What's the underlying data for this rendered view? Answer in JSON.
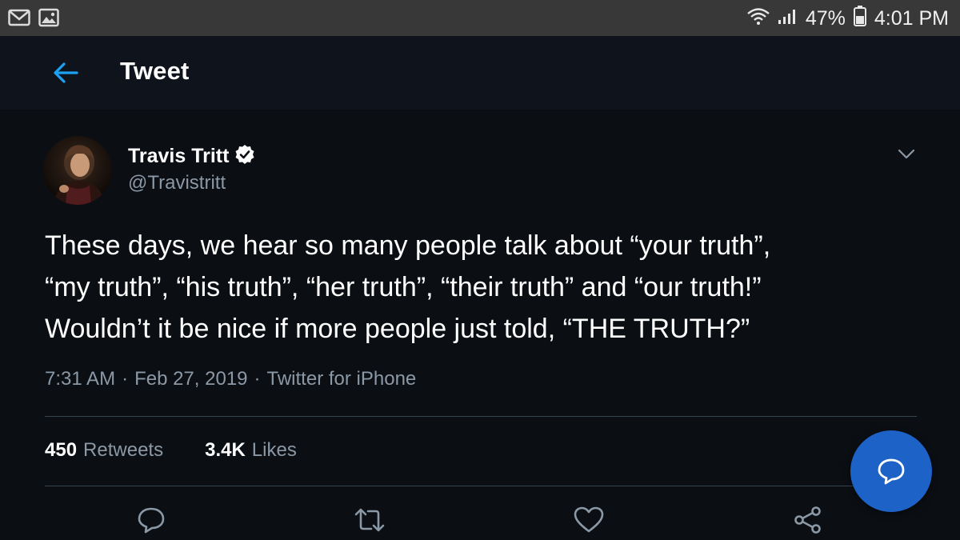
{
  "status_bar": {
    "left_icons": [
      "gmail-icon",
      "gallery-icon"
    ],
    "battery_percent": "47%",
    "time": "4:01 PM"
  },
  "app_bar": {
    "title": "Tweet"
  },
  "tweet": {
    "author": {
      "name": "Travis Tritt",
      "handle": "@Travistritt",
      "verified": true
    },
    "text_lines": [
      "These days, we hear so many people talk about “your truth”,",
      "“my truth”, “his truth”, “her truth”, “their truth” and “our truth!”",
      "Wouldn’t it be nice if more people just told, “THE TRUTH?”"
    ],
    "meta": {
      "time": "7:31 AM",
      "separator": "·",
      "date": "Feb 27, 2019",
      "source": "Twitter for iPhone"
    },
    "stats": {
      "retweets_count": "450",
      "retweets_label": "Retweets",
      "likes_count": "3.4K",
      "likes_label": "Likes"
    }
  },
  "colors": {
    "accent": "#1da1f2",
    "fab": "#1d62c7",
    "secondary_text": "#8b98a5",
    "background": "#0b0e13"
  }
}
